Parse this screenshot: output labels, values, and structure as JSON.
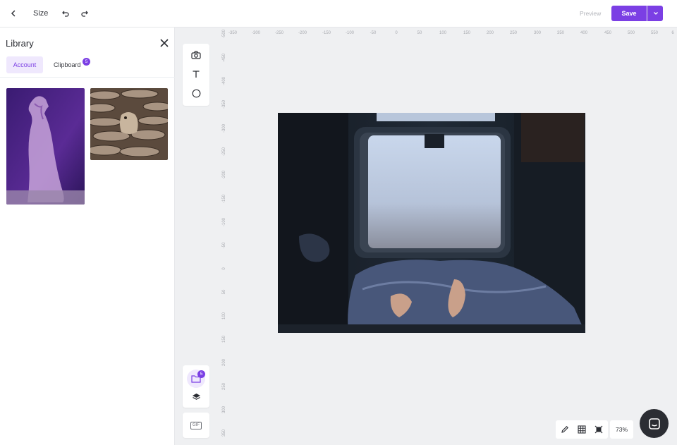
{
  "topbar": {
    "back_icon": "chevron-left-icon",
    "title": "Size",
    "undo_icon": "undo-icon",
    "redo_icon": "redo-icon",
    "preview_label": "Preview",
    "save_label": "Save",
    "save_dropdown_icon": "chevron-down-icon"
  },
  "library": {
    "title": "Library",
    "close_icon": "close-icon",
    "tabs": [
      {
        "label": "Account",
        "active": true
      },
      {
        "label": "Clipboard",
        "badge": "5"
      }
    ],
    "images": [
      {
        "name": "meerkat-purple"
      },
      {
        "name": "meerkat-stones"
      }
    ]
  },
  "ruler": {
    "top": [
      "-350",
      "-300",
      "-250",
      "-200",
      "-150",
      "-100",
      "-50",
      "0",
      "50",
      "100",
      "150",
      "200",
      "250",
      "300",
      "350",
      "400",
      "450",
      "500",
      "550",
      "6"
    ],
    "left": [
      "-500",
      "-450",
      "-400",
      "-350",
      "-300",
      "-250",
      "-200",
      "-150",
      "-100",
      "-50",
      "0",
      "50",
      "100",
      "150",
      "200",
      "250",
      "300",
      "350"
    ]
  },
  "tools": {
    "top": [
      "camera-icon",
      "text-icon",
      "circle-icon"
    ],
    "folder_badge": "5",
    "gif_label": "GIF"
  },
  "bottom": {
    "zoom": "73%"
  },
  "colors": {
    "accent": "#7b3fe4",
    "background": "#eff0f2"
  }
}
